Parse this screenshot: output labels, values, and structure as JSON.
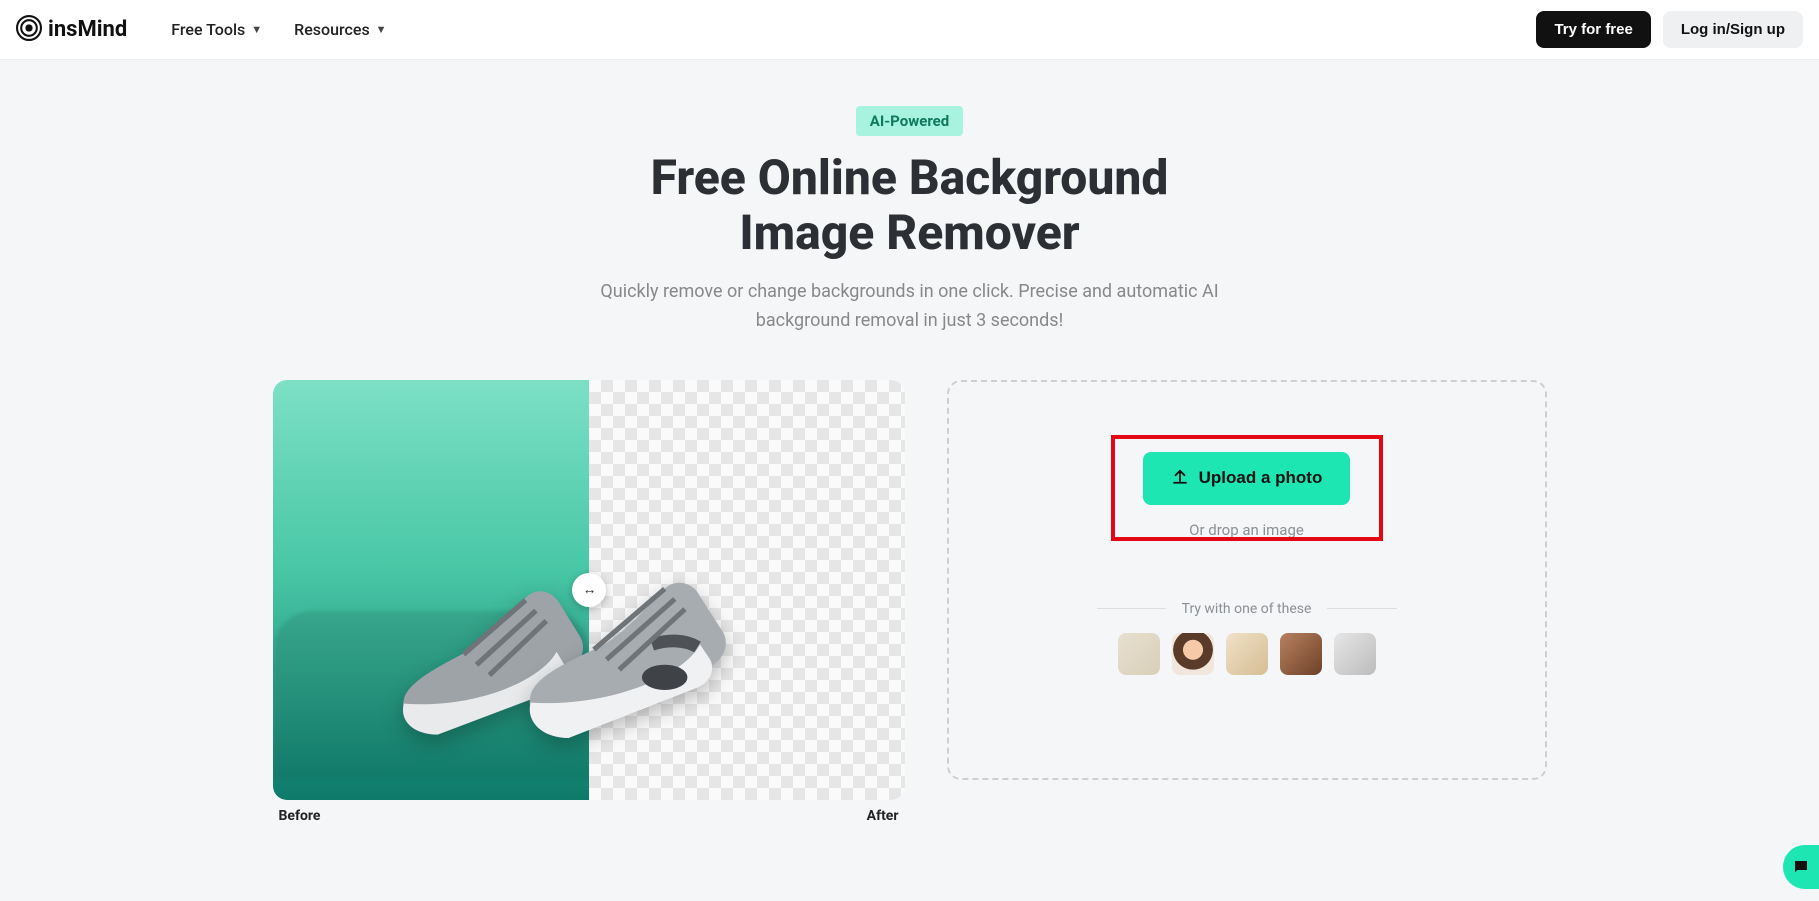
{
  "header": {
    "brand": "insMind",
    "nav": {
      "free_tools": "Free Tools",
      "resources": "Resources"
    },
    "try_label": "Try for free",
    "login_label": "Log in/Sign up"
  },
  "hero": {
    "badge": "AI-Powered",
    "title_line1": "Free Online Background",
    "title_line2": "Image Remover",
    "subtitle": "Quickly remove or change backgrounds in one click. Precise and automatic AI background removal in just 3 seconds!"
  },
  "compare": {
    "before_label": "Before",
    "after_label": "After"
  },
  "upload": {
    "button_label": "Upload a photo",
    "drop_text": "Or drop an image",
    "try_text": "Try with one of these"
  }
}
